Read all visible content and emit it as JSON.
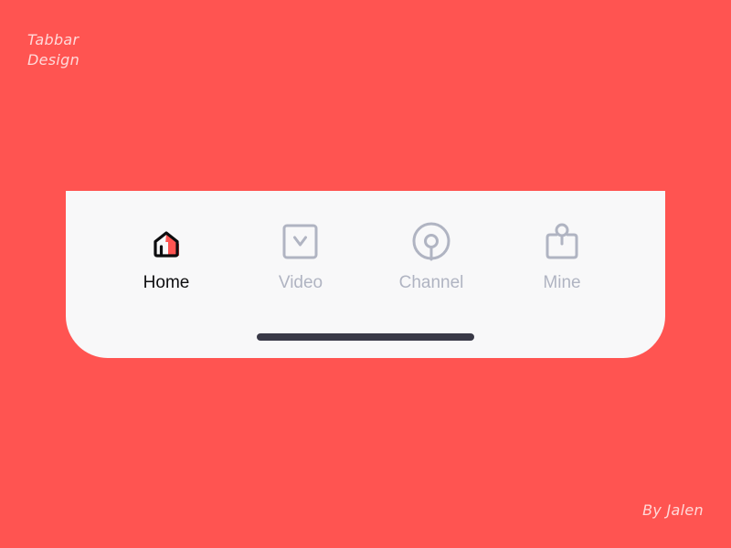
{
  "caption": {
    "title_lines": [
      "Tabbar",
      "Design"
    ],
    "author": "By Jalen"
  },
  "tabbar": {
    "tabs": [
      {
        "label": "Home",
        "icon": "home-icon",
        "active": true
      },
      {
        "label": "Video",
        "icon": "video-icon",
        "active": false
      },
      {
        "label": "Channel",
        "icon": "channel-icon",
        "active": false
      },
      {
        "label": "Mine",
        "icon": "mine-icon",
        "active": false
      }
    ]
  },
  "colors": {
    "background": "#FF5451",
    "tabbar_background": "#F8F8F9",
    "active_label": "#0D0D0F",
    "inactive": "#B0B4C2",
    "accent": "#FF5451",
    "home_indicator": "#393947"
  }
}
